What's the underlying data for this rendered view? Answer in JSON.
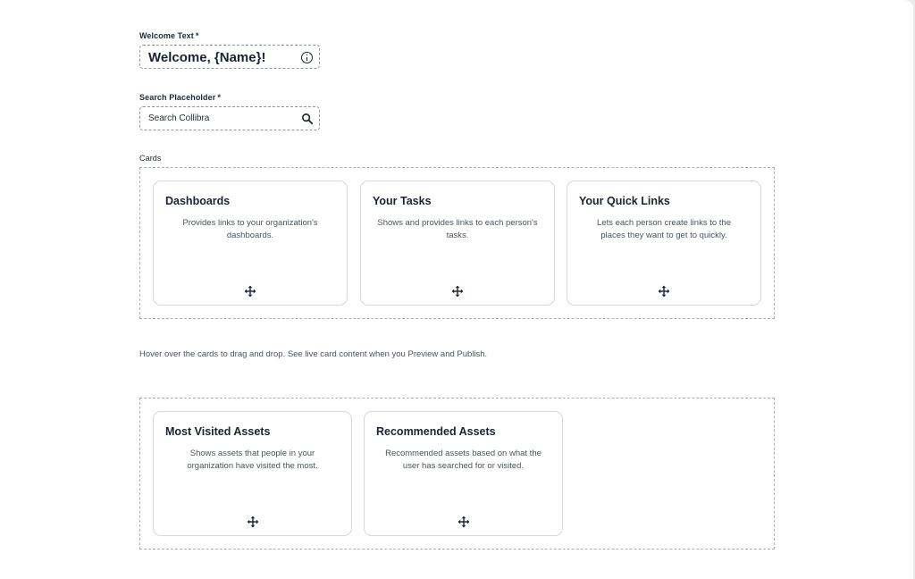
{
  "welcome": {
    "label": "Welcome Text",
    "required_mark": "*",
    "value": "Welcome, {Name}!",
    "icon": "info-icon"
  },
  "search": {
    "label": "Search Placeholder",
    "required_mark": "*",
    "value": "Search Collibra",
    "icon": "search-icon"
  },
  "cards_section": {
    "label": "Cards",
    "hint": "Hover over the cards to drag and drop. See live card content when you Preview and Publish."
  },
  "cards_row_1": [
    {
      "title": "Dashboards",
      "description": "Provides links to your organization's dashboards.",
      "icon": "move-icon"
    },
    {
      "title": "Your Tasks",
      "description": "Shows and provides links to each person's tasks.",
      "icon": "move-icon"
    },
    {
      "title": "Your Quick Links",
      "description": "Lets each person create links to the places they want to get to quickly.",
      "icon": "move-icon"
    }
  ],
  "cards_row_2": [
    {
      "title": "Most Visited Assets",
      "description": "Shows assets that people in your organization have visited the most.",
      "icon": "move-icon"
    },
    {
      "title": "Recommended Assets",
      "description": "Recommended assets based on what the user has searched for or visited.",
      "icon": "move-icon"
    }
  ],
  "colors": {
    "background": "#e9ebee",
    "panel": "#ffffff",
    "text_primary": "#1a2332",
    "text_secondary": "#4a5361",
    "border_dashed": "#a7b0bc",
    "card_border": "#d3d8df"
  }
}
